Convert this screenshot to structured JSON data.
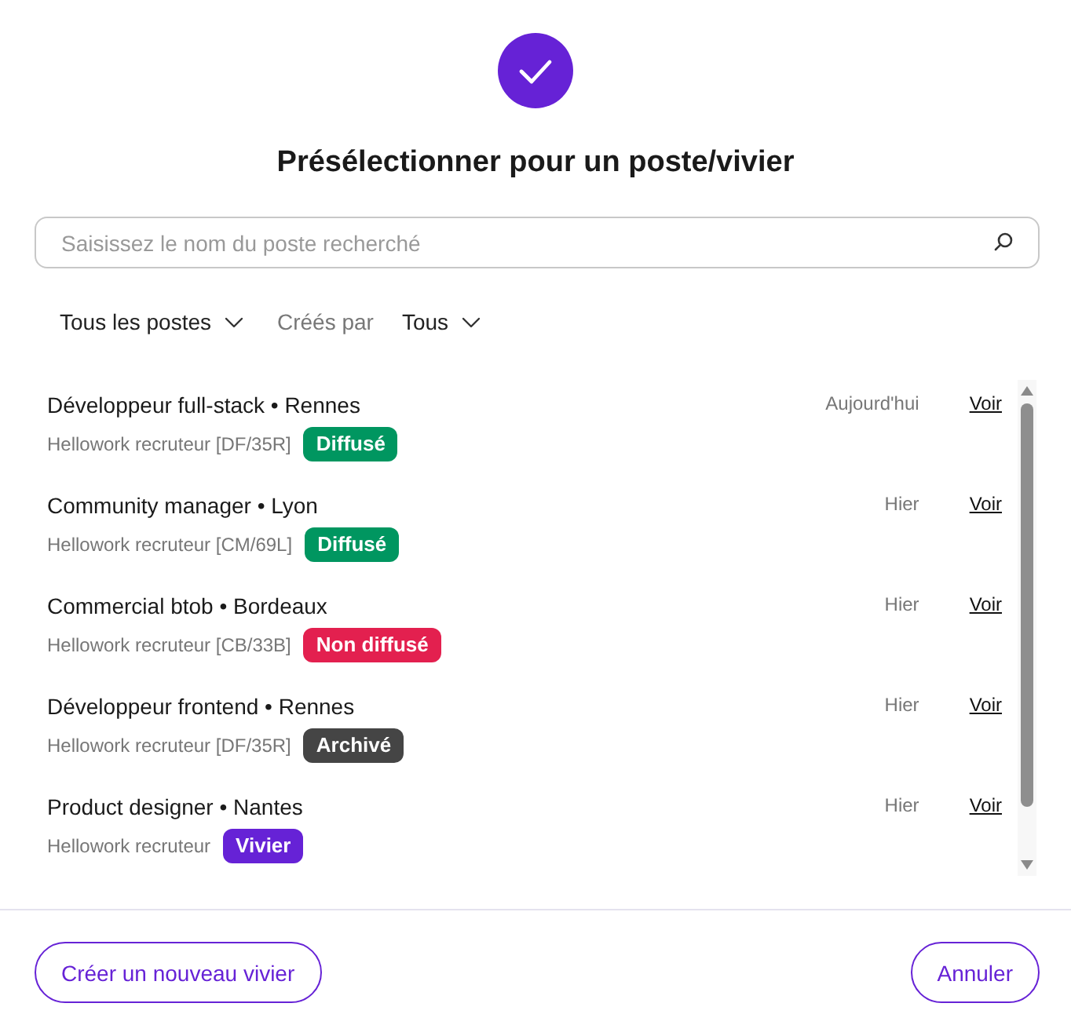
{
  "header": {
    "title": "Présélectionner pour un poste/vivier"
  },
  "search": {
    "placeholder": "Saisissez le nom du poste recherché"
  },
  "filters": [
    {
      "kind": "dropdown",
      "label": "Tous les postes"
    },
    {
      "kind": "label",
      "label": "Créés par"
    },
    {
      "kind": "dropdown",
      "label": "Tous"
    }
  ],
  "jobs": [
    {
      "title": "Développeur full-stack • Rennes",
      "recruiter": "Hellowork recruteur [DF/35R]",
      "badge": {
        "label": "Diffusé",
        "color": "#009660"
      },
      "date": "Aujourd'hui",
      "link": "Voir"
    },
    {
      "title": "Community manager • Lyon",
      "recruiter": "Hellowork recruteur [CM/69L]",
      "badge": {
        "label": "Diffusé",
        "color": "#009660"
      },
      "date": "Hier",
      "link": "Voir"
    },
    {
      "title": "Commercial btob • Bordeaux",
      "recruiter": "Hellowork recruteur [CB/33B]",
      "badge": {
        "label": "Non diffusé",
        "color": "#e3204f"
      },
      "date": "Hier",
      "link": "Voir"
    },
    {
      "title": "Développeur frontend • Rennes",
      "recruiter": "Hellowork recruteur [DF/35R]",
      "badge": {
        "label": "Archivé",
        "color": "#454545"
      },
      "date": "Hier",
      "link": "Voir"
    },
    {
      "title": "Product designer • Nantes",
      "recruiter": "Hellowork recruteur",
      "badge": {
        "label": "Vivier",
        "color": "#6622d6"
      },
      "date": "Hier",
      "link": "Voir"
    }
  ],
  "buttons": [
    {
      "label": "Créer un nouveau vivier"
    },
    {
      "label": "Annuler"
    }
  ]
}
